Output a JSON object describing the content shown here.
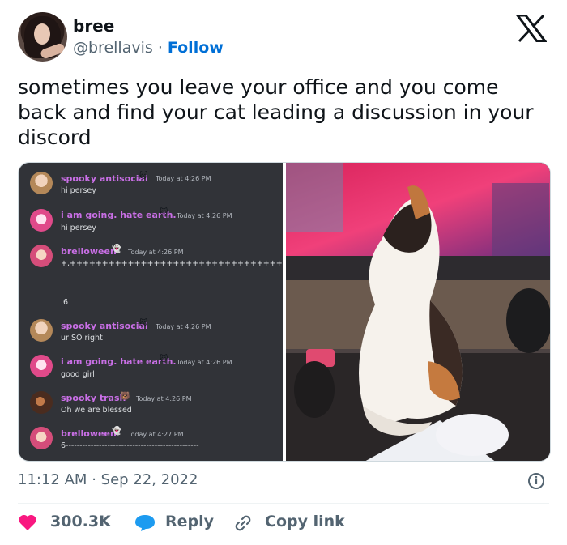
{
  "author": {
    "name": "bree",
    "handle": "@brellavis",
    "separator": "·",
    "follow_label": "Follow"
  },
  "tweet": {
    "text": "sometimes you leave your office and you come back and find your cat leading a discussion in your discord"
  },
  "discord": {
    "messages": [
      {
        "name": "spooky antisocial",
        "name_color": "#c96fe6",
        "badge": "🐱",
        "time": "Today at 4:26 PM",
        "lines": [
          "hi persey"
        ]
      },
      {
        "name": "i am going. hate earth.",
        "name_color": "#c96fe6",
        "badge": "🐱",
        "time": "Today at 4:26 PM",
        "lines": [
          "hi persey"
        ]
      },
      {
        "name": "brelloween",
        "name_color": "#c96fe6",
        "badge": "👻",
        "time": "Today at 4:26 PM",
        "lines": [
          "+,+++++++++++++++++++++++++++++++++++",
          ".",
          ".",
          ".6"
        ]
      },
      {
        "name": "spooky antisocial",
        "name_color": "#c96fe6",
        "badge": "🐱",
        "time": "Today at 4:26 PM",
        "lines": [
          "ur SO right"
        ]
      },
      {
        "name": "i am going. hate earth.",
        "name_color": "#c96fe6",
        "badge": "🐱",
        "time": "Today at 4:26 PM",
        "lines": [
          "good girl"
        ]
      },
      {
        "name": "spooky trash",
        "name_color": "#c96fe6",
        "badge": "🐻",
        "time": "Today at 4:26 PM",
        "lines": [
          "Oh we are blessed"
        ]
      },
      {
        "name": "brelloween",
        "name_color": "#c96fe6",
        "badge": "👻",
        "time": "Today at 4:27 PM",
        "lines": [
          "6------------------------------------------------"
        ]
      }
    ]
  },
  "meta": {
    "time": "11:12 AM",
    "dot": "·",
    "date": "Sep 22, 2022"
  },
  "actions": {
    "likes": "300.3K",
    "reply": "Reply",
    "copy_link": "Copy link"
  },
  "icons": {
    "heart": "heart-icon",
    "reply": "reply-bubble-icon",
    "link": "link-icon",
    "info": "info-icon",
    "x_logo": "x-logo-icon"
  },
  "colors": {
    "follow": "#006fd6",
    "heart": "#f91880",
    "reply_bubble": "#1d9bf0",
    "discord_bg": "#313338"
  }
}
